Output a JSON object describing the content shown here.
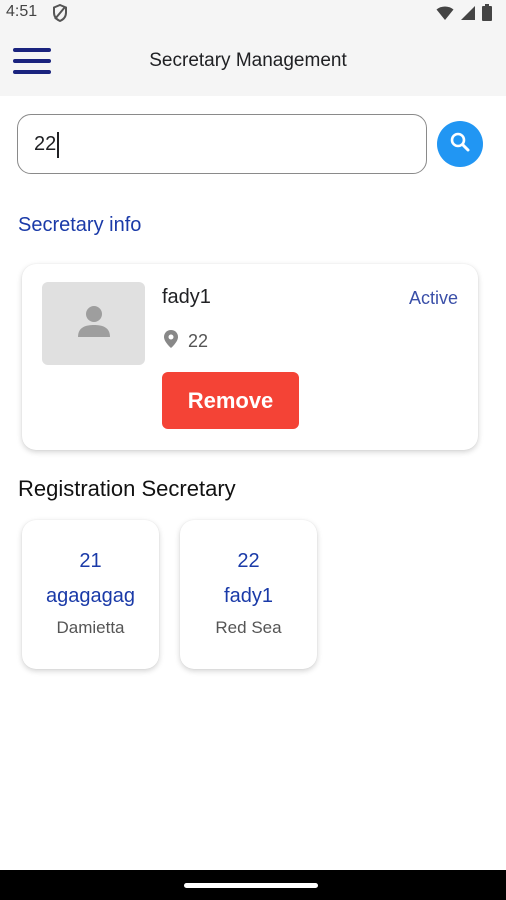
{
  "status_bar": {
    "time": "4:51"
  },
  "app_bar": {
    "title": "Secretary Management",
    "menu_icon": "hamburger-menu-icon"
  },
  "search": {
    "value": "22",
    "placeholder": "",
    "button_icon": "search-icon"
  },
  "secretary_info": {
    "section_title": "Secretary info",
    "name": "fady1",
    "status": "Active",
    "location": "22",
    "remove_label": "Remove"
  },
  "registration": {
    "title": "Registration Secretary",
    "items": [
      {
        "id": "21",
        "name": "agagagag",
        "city": "Damietta"
      },
      {
        "id": "22",
        "name": "fady1",
        "city": "Red Sea"
      }
    ]
  },
  "colors": {
    "accent": "#2196f3",
    "primary_text": "#1a3aa8",
    "danger": "#f44336",
    "menu": "#1a237e"
  }
}
